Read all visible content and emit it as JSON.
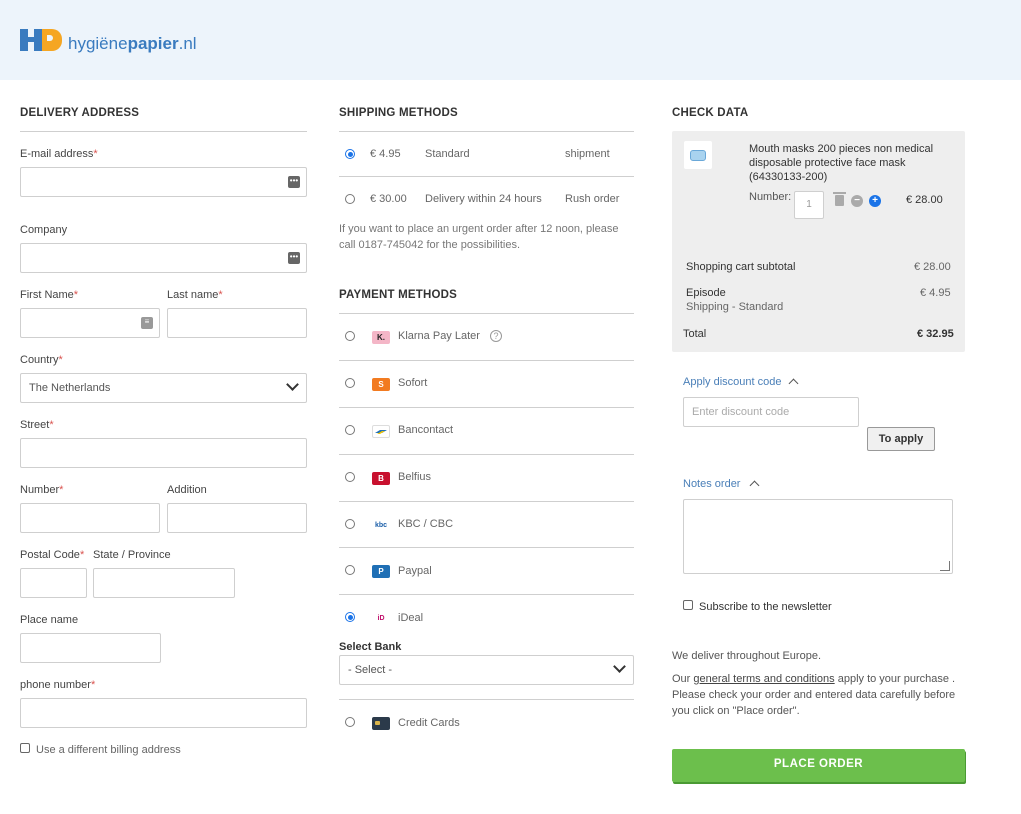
{
  "brand": {
    "name_part1": "hygiëne",
    "name_part2": "papier",
    "name_part3": ".nl"
  },
  "delivery": {
    "title": "DELIVERY ADDRESS",
    "email_label": "E-mail address",
    "company_label": "Company",
    "first_name_label": "First Name",
    "last_name_label": "Last name",
    "country_label": "Country",
    "country_value": "The Netherlands",
    "street_label": "Street",
    "number_label": "Number",
    "addition_label": "Addition",
    "postal_label": "Postal Code",
    "state_label": "State / Province",
    "place_label": "Place name",
    "phone_label": "phone number",
    "billing_checkbox_label": "Use a different billing address",
    "required_mark": "*"
  },
  "shipping": {
    "title": "SHIPPING METHODS",
    "options": [
      {
        "price": "€ 4.95",
        "name": "Standard",
        "type": "shipment",
        "selected": true
      },
      {
        "price": "€ 30.00",
        "name": "Delivery within 24 hours",
        "type": "Rush order",
        "selected": false
      }
    ],
    "note": "If you want to place an urgent order after 12 noon, please call 0187-745042 for the possibilities."
  },
  "payment": {
    "title": "PAYMENT METHODS",
    "options": [
      {
        "name": "Klarna Pay Later",
        "icon": "klarna-icon",
        "icon_text": "K.",
        "color": "#f4b6c7"
      },
      {
        "name": "Sofort",
        "icon": "sofort-icon",
        "icon_text": "S",
        "color": "#f27b21"
      },
      {
        "name": "Bancontact",
        "icon": "bancontact-icon",
        "icon_text": "",
        "color": "#ffffff"
      },
      {
        "name": "Belfius",
        "icon": "belfius-icon",
        "icon_text": "B",
        "color": "#c8102e"
      },
      {
        "name": "KBC / CBC",
        "icon": "kbc-icon",
        "icon_text": "kbc",
        "color": "#ffffff"
      },
      {
        "name": "Paypal",
        "icon": "paypal-icon",
        "icon_text": "P",
        "color": "#1f6fb5"
      },
      {
        "name": "iDeal",
        "icon": "ideal-icon",
        "icon_text": "iD",
        "color": "#ffffff"
      },
      {
        "name": "Credit Cards",
        "icon": "credit-card-icon",
        "icon_text": "",
        "color": "#2b3a4a"
      }
    ],
    "selected": "iDeal",
    "bank_label": "Select Bank",
    "bank_value": "- Select -"
  },
  "check": {
    "title": "CHECK DATA",
    "product_name": "Mouth masks 200 pieces non medical disposable protective face mask (64330133-200)",
    "number_label": "Number:",
    "qty_value": "1",
    "line_total": "€ 28.00",
    "subtotal_label": "Shopping cart subtotal",
    "subtotal_value": "€ 28.00",
    "episode_label": "Episode",
    "episode_sub": "Shipping - Standard",
    "episode_value": "€ 4.95",
    "total_label": "Total",
    "total_value": "€ 32.95",
    "discount_link": "Apply discount code",
    "discount_placeholder": "Enter discount code",
    "apply_button": "To apply",
    "notes_link": "Notes order",
    "newsletter_label": "Subscribe to the newsletter",
    "deliver_text": "We deliver throughout Europe.",
    "terms_prefix": "Our ",
    "terms_link": "general terms and conditions",
    "terms_suffix": " apply to your purchase . Please check your order and entered data carefully before you click on \"Place order\".",
    "place_order": "PLACE ORDER"
  }
}
